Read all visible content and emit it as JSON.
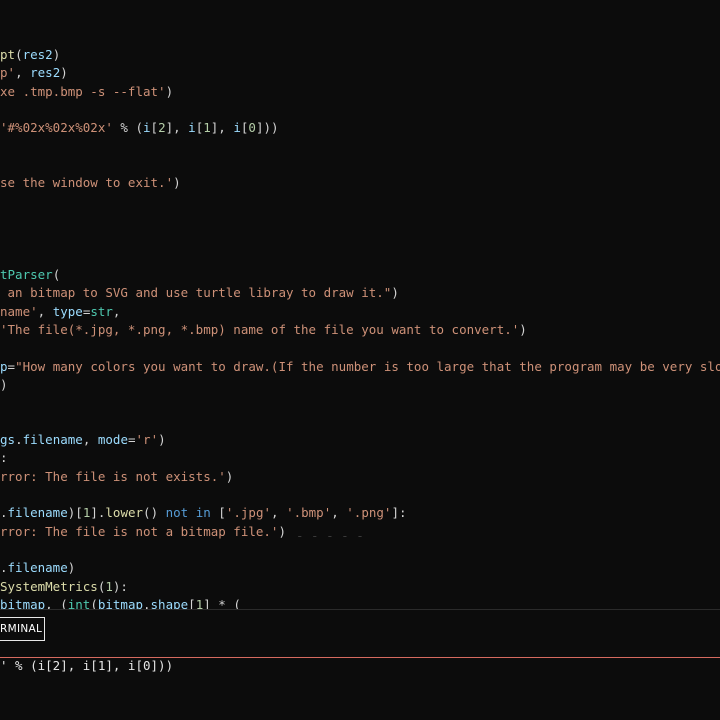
{
  "editor": {
    "lines": [
      {
        "tokens": [
          {
            "t": "pt",
            "c": "fn"
          },
          {
            "t": "(",
            "c": "def"
          },
          {
            "t": "res2",
            "c": "var"
          },
          {
            "t": ")",
            "c": "def"
          }
        ]
      },
      {
        "tokens": [
          {
            "t": "p'",
            "c": "str"
          },
          {
            "t": ", ",
            "c": "def"
          },
          {
            "t": "res2",
            "c": "var"
          },
          {
            "t": ")",
            "c": "def"
          }
        ]
      },
      {
        "tokens": [
          {
            "t": "xe .tmp.bmp -s --flat'",
            "c": "str"
          },
          {
            "t": ")",
            "c": "def"
          }
        ]
      },
      {
        "tokens": []
      },
      {
        "tokens": [
          {
            "t": "'#%02x%02x%02x'",
            "c": "str"
          },
          {
            "t": " % (",
            "c": "def"
          },
          {
            "t": "i",
            "c": "var"
          },
          {
            "t": "[",
            "c": "def"
          },
          {
            "t": "2",
            "c": "num"
          },
          {
            "t": "], ",
            "c": "def"
          },
          {
            "t": "i",
            "c": "var"
          },
          {
            "t": "[",
            "c": "def"
          },
          {
            "t": "1",
            "c": "num"
          },
          {
            "t": "], ",
            "c": "def"
          },
          {
            "t": "i",
            "c": "var"
          },
          {
            "t": "[",
            "c": "def"
          },
          {
            "t": "0",
            "c": "num"
          },
          {
            "t": "]))",
            "c": "def"
          }
        ]
      },
      {
        "tokens": []
      },
      {
        "tokens": []
      },
      {
        "tokens": [
          {
            "t": "se the window to exit.'",
            "c": "str"
          },
          {
            "t": ")",
            "c": "def"
          }
        ]
      },
      {
        "tokens": []
      },
      {
        "tokens": []
      },
      {
        "tokens": []
      },
      {
        "tokens": []
      },
      {
        "tokens": [
          {
            "t": "tParser",
            "c": "cls"
          },
          {
            "t": "(",
            "c": "def"
          }
        ]
      },
      {
        "tokens": [
          {
            "t": " an bitmap to SVG and use turtle libray to draw it.\"",
            "c": "str"
          },
          {
            "t": ")",
            "c": "def"
          }
        ]
      },
      {
        "tokens": [
          {
            "t": "name'",
            "c": "str"
          },
          {
            "t": ", ",
            "c": "def"
          },
          {
            "t": "type",
            "c": "var"
          },
          {
            "t": "=",
            "c": "def"
          },
          {
            "t": "str",
            "c": "cls"
          },
          {
            "t": ",",
            "c": "def"
          }
        ]
      },
      {
        "tokens": [
          {
            "t": "'The file(*.jpg, *.png, *.bmp) name of the file you want to convert.'",
            "c": "str"
          },
          {
            "t": ")",
            "c": "def"
          }
        ]
      },
      {
        "tokens": []
      },
      {
        "tokens": [
          {
            "t": "p",
            "c": "var"
          },
          {
            "t": "=",
            "c": "def"
          },
          {
            "t": "\"How many colors you want to draw.(If the number is too large that the program may be very slow.)\"",
            "c": "str"
          }
        ]
      },
      {
        "tokens": [
          {
            "t": ")",
            "c": "def"
          }
        ]
      },
      {
        "tokens": []
      },
      {
        "tokens": []
      },
      {
        "tokens": [
          {
            "t": "gs",
            "c": "var"
          },
          {
            "t": ".",
            "c": "def"
          },
          {
            "t": "filename",
            "c": "var"
          },
          {
            "t": ", ",
            "c": "def"
          },
          {
            "t": "mode",
            "c": "var"
          },
          {
            "t": "=",
            "c": "def"
          },
          {
            "t": "'r'",
            "c": "str"
          },
          {
            "t": ")",
            "c": "def"
          }
        ]
      },
      {
        "tokens": [
          {
            "t": ":",
            "c": "def"
          }
        ]
      },
      {
        "tokens": [
          {
            "t": "rror: The file is not exists.'",
            "c": "str"
          },
          {
            "t": ")",
            "c": "def"
          }
        ]
      },
      {
        "tokens": []
      },
      {
        "tokens": [
          {
            "t": ".",
            "c": "def"
          },
          {
            "t": "filename",
            "c": "var"
          },
          {
            "t": ")[",
            "c": "def"
          },
          {
            "t": "1",
            "c": "num"
          },
          {
            "t": "].",
            "c": "def"
          },
          {
            "t": "lower",
            "c": "fn"
          },
          {
            "t": "() ",
            "c": "def"
          },
          {
            "t": "not in",
            "c": "kw"
          },
          {
            "t": " [",
            "c": "def"
          },
          {
            "t": "'.jpg'",
            "c": "str"
          },
          {
            "t": ", ",
            "c": "def"
          },
          {
            "t": "'.bmp'",
            "c": "str"
          },
          {
            "t": ", ",
            "c": "def"
          },
          {
            "t": "'.png'",
            "c": "str"
          },
          {
            "t": "]:",
            "c": "def"
          }
        ]
      },
      {
        "tokens": [
          {
            "t": "rror: The file is not a bitmap file.'",
            "c": "str"
          },
          {
            "t": ")",
            "c": "def"
          }
        ]
      },
      {
        "tokens": []
      },
      {
        "tokens": [
          {
            "t": ".",
            "c": "def"
          },
          {
            "t": "filename",
            "c": "var"
          },
          {
            "t": ")",
            "c": "def"
          }
        ]
      },
      {
        "tokens": [
          {
            "t": "SystemMetrics",
            "c": "fn"
          },
          {
            "t": "(",
            "c": "def"
          },
          {
            "t": "1",
            "c": "num"
          },
          {
            "t": "):",
            "c": "def"
          }
        ]
      },
      {
        "tokens": [
          {
            "t": "bitmap",
            "c": "var"
          },
          {
            "t": ", (",
            "c": "def"
          },
          {
            "t": "int",
            "c": "cls"
          },
          {
            "t": "(",
            "c": "def"
          },
          {
            "t": "bitmap",
            "c": "var"
          },
          {
            "t": ".",
            "c": "def"
          },
          {
            "t": "shape",
            "c": "var"
          },
          {
            "t": "[",
            "c": "def"
          },
          {
            "t": "1",
            "c": "num"
          },
          {
            "t": "] * (",
            "c": "def"
          }
        ]
      }
    ],
    "ghost_text": "- - - - -"
  },
  "panel": {
    "terminal_tab_label": "RMINAL"
  },
  "terminal": {
    "output_line": "' % (i[2], i[1], i[0]))"
  }
}
